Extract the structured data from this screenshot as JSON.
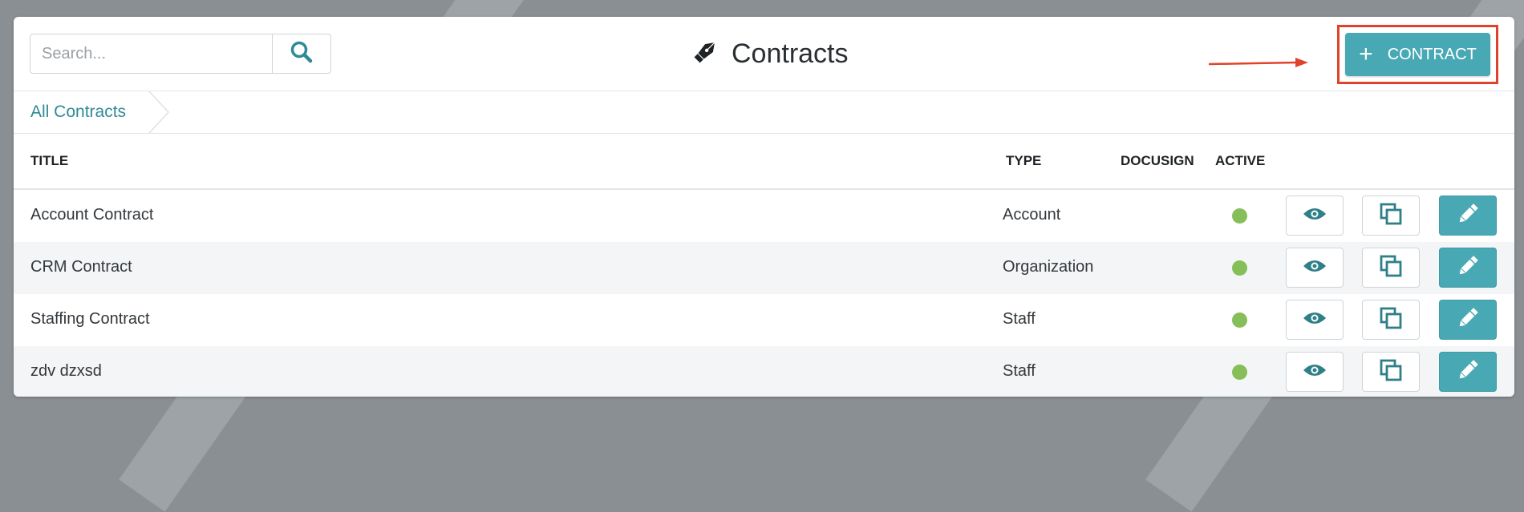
{
  "search": {
    "placeholder": "Search...",
    "value": ""
  },
  "header": {
    "title": "Contracts",
    "add_button_label": "CONTRACT",
    "add_button_icon": "plus-icon"
  },
  "breadcrumb": {
    "current": "All Contracts"
  },
  "table": {
    "columns": {
      "title": "TITLE",
      "type": "TYPE",
      "docusign": "DOCUSIGN",
      "active": "ACTIVE"
    },
    "rows": [
      {
        "title": "Account Contract",
        "type": "Account",
        "docusign": "",
        "active": true
      },
      {
        "title": "CRM Contract",
        "type": "Organization",
        "docusign": "",
        "active": true
      },
      {
        "title": "Staffing Contract",
        "type": "Staff",
        "docusign": "",
        "active": true
      },
      {
        "title": "zdv dzxsd",
        "type": "Staff",
        "docusign": "",
        "active": true
      }
    ]
  },
  "colors": {
    "accent": "#48a9b4",
    "active_status": "#86be5a",
    "annotation": "#e0432b",
    "link": "#2f8a95"
  }
}
